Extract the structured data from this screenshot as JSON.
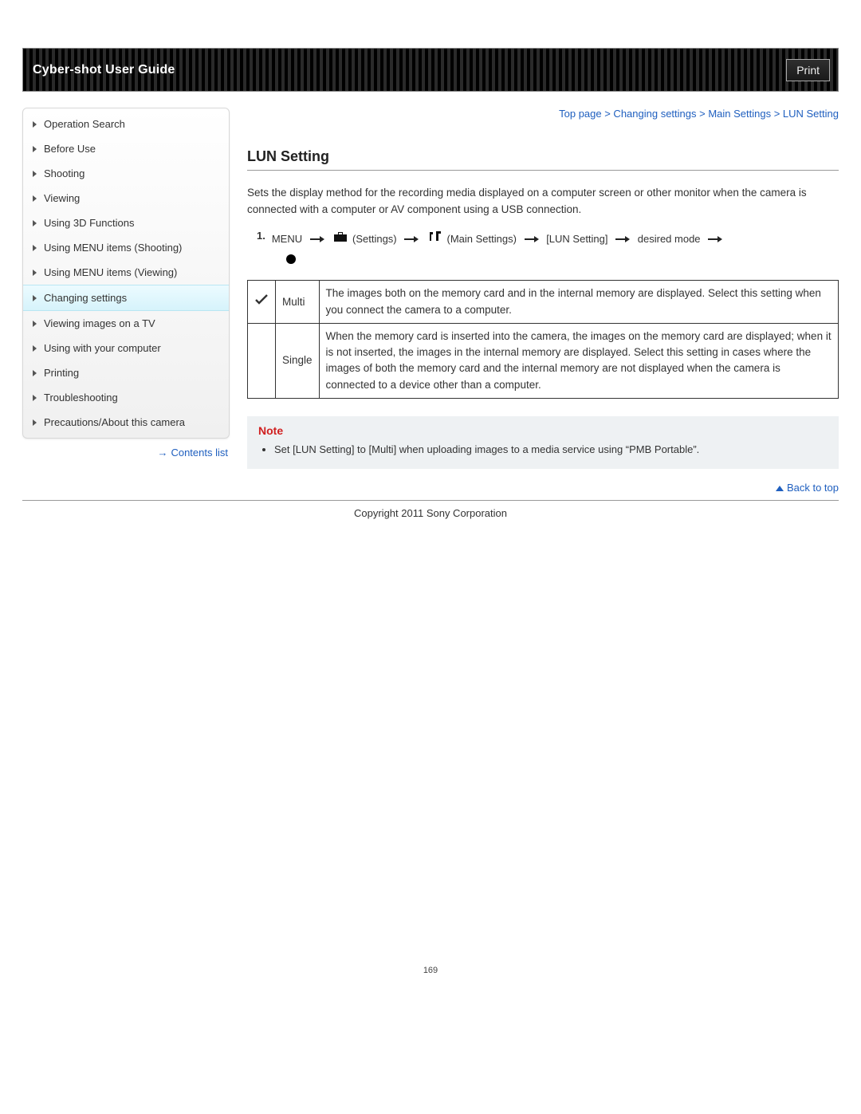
{
  "header": {
    "title": "Cyber-shot User Guide",
    "print_label": "Print"
  },
  "breadcrumb": "Top page > Changing settings > Main Settings > LUN Setting",
  "sidebar": {
    "items": [
      {
        "label": "Operation Search"
      },
      {
        "label": "Before Use"
      },
      {
        "label": "Shooting"
      },
      {
        "label": "Viewing"
      },
      {
        "label": "Using 3D Functions"
      },
      {
        "label": "Using MENU items (Shooting)"
      },
      {
        "label": "Using MENU items (Viewing)"
      },
      {
        "label": "Changing settings",
        "active": true
      },
      {
        "label": "Viewing images on a TV"
      },
      {
        "label": "Using with your computer"
      },
      {
        "label": "Printing"
      },
      {
        "label": "Troubleshooting"
      },
      {
        "label": "Precautions/About this camera"
      }
    ],
    "contents_link": "Contents list"
  },
  "page": {
    "title": "LUN Setting",
    "description": "Sets the display method for the recording media displayed on a computer screen or other monitor when the camera is connected with a computer or AV component using a USB connection.",
    "step_number": "1.",
    "step_parts": {
      "menu": "MENU",
      "settings": "(Settings)",
      "main_settings": "(Main Settings)",
      "lun": "[LUN Setting]",
      "desired": "desired mode"
    },
    "options": [
      {
        "check": true,
        "name": "Multi",
        "desc": "The images both on the memory card and in the internal memory are displayed. Select this setting when you connect the camera to a computer."
      },
      {
        "check": false,
        "name": "Single",
        "desc": "When the memory card is inserted into the camera, the images on the memory card are displayed; when it is not inserted, the images in the internal memory are displayed. Select this setting in cases where the images of both the memory card and the internal memory are not displayed when the camera is connected to a device other than a computer."
      }
    ],
    "note_title": "Note",
    "note_items": [
      "Set [LUN Setting] to [Multi] when uploading images to a media service using “PMB Portable”."
    ],
    "back_to_top": "Back to top",
    "copyright": "Copyright 2011 Sony Corporation",
    "page_number": "169"
  }
}
